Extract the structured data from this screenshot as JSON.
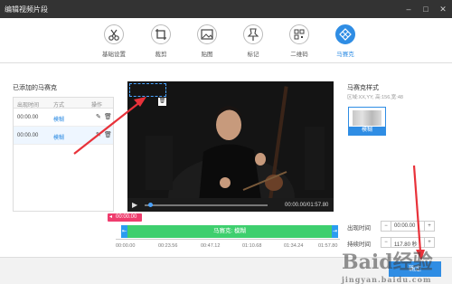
{
  "window": {
    "title": "编辑视频片段",
    "min": "–",
    "max": "□",
    "close": "✕"
  },
  "toolbar": {
    "items": [
      {
        "label": "基础设置",
        "icon": "scissors-icon",
        "active": false
      },
      {
        "label": "裁剪",
        "icon": "crop-icon",
        "active": false
      },
      {
        "label": "贴图",
        "icon": "image-icon",
        "active": false
      },
      {
        "label": "标记",
        "icon": "pin-icon",
        "active": false
      },
      {
        "label": "二维码",
        "icon": "qrcode-icon",
        "active": false
      },
      {
        "label": "马赛克",
        "icon": "mosaic-icon",
        "active": true
      }
    ]
  },
  "list": {
    "title": "已添加的马赛克",
    "headers": [
      "出现时间",
      "方式",
      "操作"
    ],
    "rows": [
      {
        "time": "00:00.00",
        "mode": "模糊"
      },
      {
        "time": "00:00.00",
        "mode": "模糊"
      }
    ]
  },
  "video": {
    "time_display": "00:00.00/01:57.80",
    "mosaic_delete": "🗑"
  },
  "timeline": {
    "current_badge": "00:00.00",
    "track_label": "马赛克: 模糊",
    "ticks": [
      "00:00.00",
      "00:23.56",
      "00:47.12",
      "01:10.68",
      "01:34.24",
      "01:57.80"
    ]
  },
  "style": {
    "title": "马赛克样式",
    "info": "区域:XX,YY, 高:156,宽:48",
    "option_label": "模糊",
    "appear_label": "出现时间",
    "appear_value": "00:00.00",
    "duration_label": "持续时间",
    "duration_value": "117.80 秒"
  },
  "footer": {
    "ok": "确定"
  },
  "watermark": {
    "text": "Baid经验",
    "sub": "jingyan.baidu.com"
  },
  "colors": {
    "accent": "#2f8de4",
    "track": "#3ecf6e",
    "badge": "#ef3d6e",
    "arrow": "#e8323a"
  }
}
